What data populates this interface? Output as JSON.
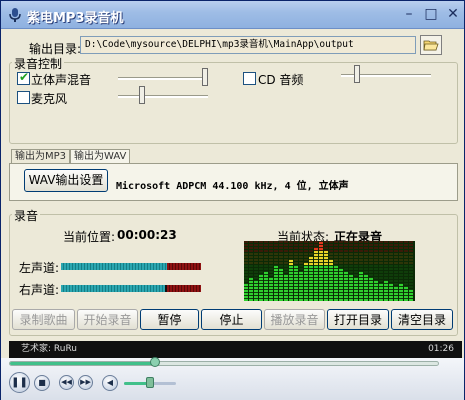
{
  "window": {
    "title": "紫电MP3录音机",
    "minimize_glyph": "–",
    "maximize_glyph": "□",
    "close_glyph": "✕"
  },
  "output": {
    "label": "输出目录:",
    "path": "D:\\Code\\mysource\\DELPHI\\mp3录音机\\MainApp\\output",
    "browse_icon": "folder-open-icon"
  },
  "record_control": {
    "group_label": "录音控制",
    "stereo_mix": {
      "label": "立体声混音",
      "checked": true,
      "level": 1.0
    },
    "cd_audio": {
      "label": "CD 音频",
      "checked": false,
      "level": 0.18
    },
    "microphone": {
      "label": "麦克风",
      "checked": false,
      "level": 0.27
    }
  },
  "tabs": [
    {
      "label": "输出为MP3",
      "active": false
    },
    {
      "label": "输出为WAV",
      "active": true
    }
  ],
  "wav": {
    "settings_button": "WAV输出设置",
    "format_info": "Microsoft ADPCM 44.100 kHz, 4 位, 立体声"
  },
  "recording": {
    "group_label": "录音",
    "position_label": "当前位置:",
    "position_value": "00:00:23",
    "status_label": "当前状态:",
    "status_value": "正在录音",
    "left_channel_label": "左声道:",
    "right_channel_label": "右声道:",
    "left_level": 0.76,
    "right_level": 0.74
  },
  "actions": [
    {
      "label": "录制歌曲",
      "enabled": false
    },
    {
      "label": "开始录音",
      "enabled": false
    },
    {
      "label": "暂停",
      "enabled": true
    },
    {
      "label": "停止",
      "enabled": true
    },
    {
      "label": "播放录音",
      "enabled": false
    },
    {
      "label": "打开目录",
      "enabled": true
    },
    {
      "label": "清空目录",
      "enabled": true
    }
  ],
  "player": {
    "artist_line": "艺术家: RuRu",
    "time": "01:26",
    "seek_progress": 0.34,
    "volume": 0.5
  },
  "colors": {
    "vu_cyan": "#2ba6b0",
    "vu_red": "#8e1212",
    "spectrum_green": "#2fd02f",
    "spectrum_yellow": "#e8d52a",
    "spectrum_red": "#e23a1e"
  }
}
